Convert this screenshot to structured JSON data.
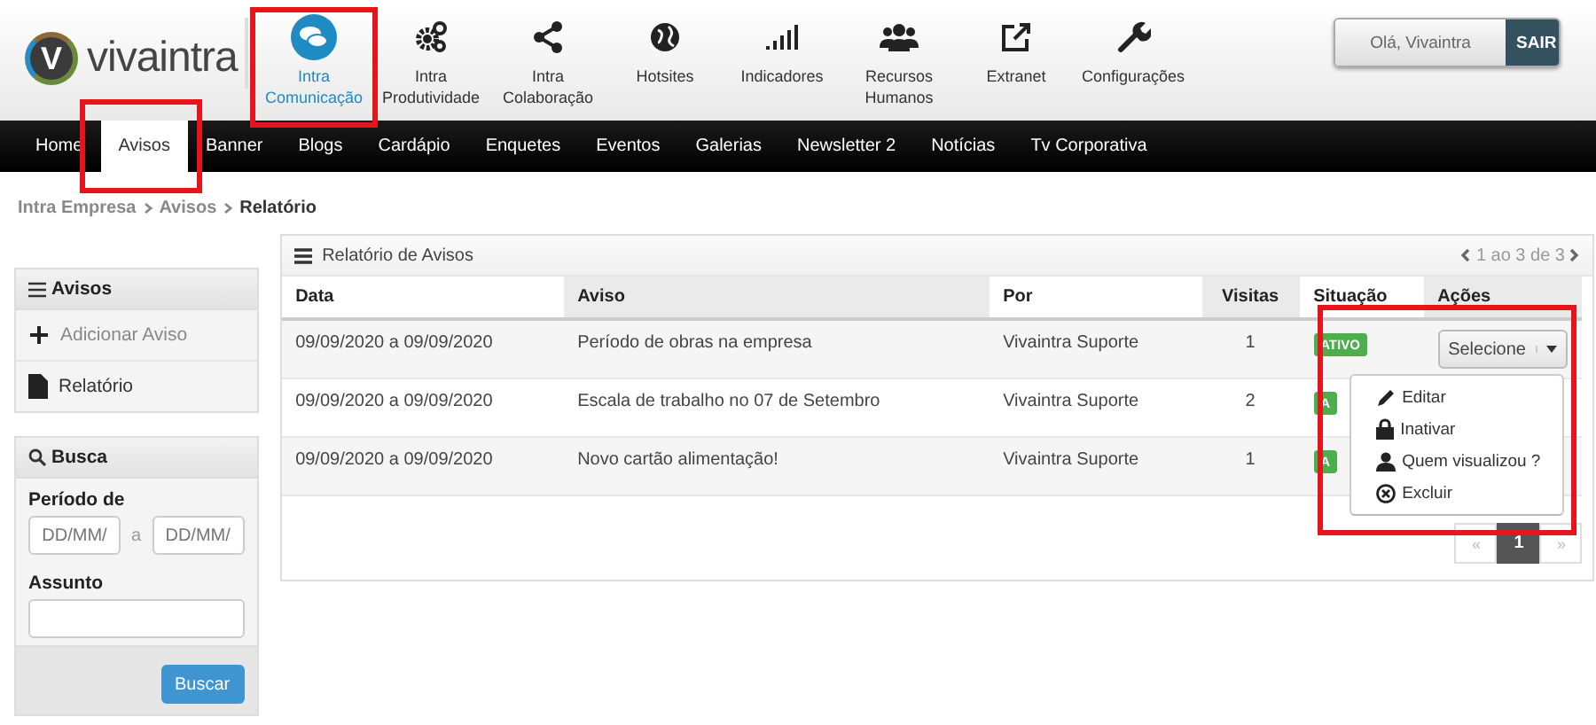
{
  "logo": {
    "mark": "V",
    "text": "vivaintra"
  },
  "modules": [
    {
      "kind": "chat",
      "label": "Intra Comunicação",
      "selected": true,
      "highlighted": true
    },
    {
      "kind": "gears",
      "label": "Intra Produtividade",
      "selected": false,
      "highlighted": false
    },
    {
      "kind": "share",
      "label": "Intra Colaboração",
      "selected": false,
      "highlighted": false
    },
    {
      "kind": "globe",
      "label": "Hotsites",
      "selected": false,
      "highlighted": false
    },
    {
      "kind": "bars",
      "label": "Indicadores",
      "selected": false,
      "highlighted": false
    },
    {
      "kind": "people",
      "label": "Recursos Humanos",
      "selected": false,
      "highlighted": false
    },
    {
      "kind": "external",
      "label": "Extranet",
      "selected": false,
      "highlighted": false
    },
    {
      "kind": "wrench",
      "label": "Configurações",
      "selected": false,
      "highlighted": false
    }
  ],
  "user": {
    "greeting": "Olá, Vivaintra",
    "logout": "SAIR"
  },
  "nav": [
    {
      "label": "Home",
      "selected": false,
      "highlighted": false
    },
    {
      "label": "Avisos",
      "selected": true,
      "highlighted": true
    },
    {
      "label": "Banner",
      "selected": false,
      "highlighted": false
    },
    {
      "label": "Blogs",
      "selected": false,
      "highlighted": false
    },
    {
      "label": "Cardápio",
      "selected": false,
      "highlighted": false
    },
    {
      "label": "Enquetes",
      "selected": false,
      "highlighted": false
    },
    {
      "label": "Eventos",
      "selected": false,
      "highlighted": false
    },
    {
      "label": "Galerias",
      "selected": false,
      "highlighted": false
    },
    {
      "label": "Newsletter 2",
      "selected": false,
      "highlighted": false
    },
    {
      "label": "Notícias",
      "selected": false,
      "highlighted": false
    },
    {
      "label": "Tv Corporativa",
      "selected": false,
      "highlighted": false
    }
  ],
  "breadcrumb": [
    "Intra Empresa",
    "Avisos",
    "Relatório"
  ],
  "sidebar": {
    "menu_title": "Avisos",
    "items": [
      {
        "kind": "add",
        "label": "Adicionar Aviso"
      },
      {
        "kind": "file",
        "label": "Relatório"
      }
    ],
    "search": {
      "title": "Busca",
      "period_label": "Período de",
      "from_placeholder": "DD/MM/",
      "separator": "a",
      "to_placeholder": "DD/MM/",
      "subject_label": "Assunto",
      "button": "Buscar"
    }
  },
  "report": {
    "title": "Relatório de Avisos",
    "range": "1 ao 3 de 3",
    "highlighted": true,
    "columns": [
      {
        "label": "Data",
        "sorted": false
      },
      {
        "label": "Aviso",
        "sorted": true
      },
      {
        "label": "Por",
        "sorted": false
      },
      {
        "label": "Visitas",
        "sorted": true
      },
      {
        "label": "Situação",
        "sorted": false
      },
      {
        "label": "Ações",
        "sorted": true
      }
    ],
    "rows": [
      {
        "data": "09/09/2020 a 09/09/2020",
        "aviso": "Período de obras na empresa",
        "por": "Vivaintra Suporte",
        "visitas": "1",
        "status": "ATIVO"
      },
      {
        "data": "09/09/2020 a 09/09/2020",
        "aviso": "Escala de trabalho no 07 de Setembro",
        "por": "Vivaintra Suporte",
        "visitas": "2",
        "status": "A"
      },
      {
        "data": "09/09/2020 a 09/09/2020",
        "aviso": "Novo cartão alimentação!",
        "por": "Vivaintra Suporte",
        "visitas": "1",
        "status": "A"
      }
    ],
    "action_button": "Selecione",
    "action_menu": [
      {
        "kind": "edit",
        "label": "Editar"
      },
      {
        "kind": "lock",
        "label": "Inativar"
      },
      {
        "kind": "user",
        "label": "Quem visualizou ?"
      },
      {
        "kind": "remove",
        "label": "Excluir"
      }
    ],
    "pagination": {
      "prev": "«",
      "pages": [
        {
          "label": "1",
          "selected": true
        }
      ],
      "next": "»"
    }
  }
}
